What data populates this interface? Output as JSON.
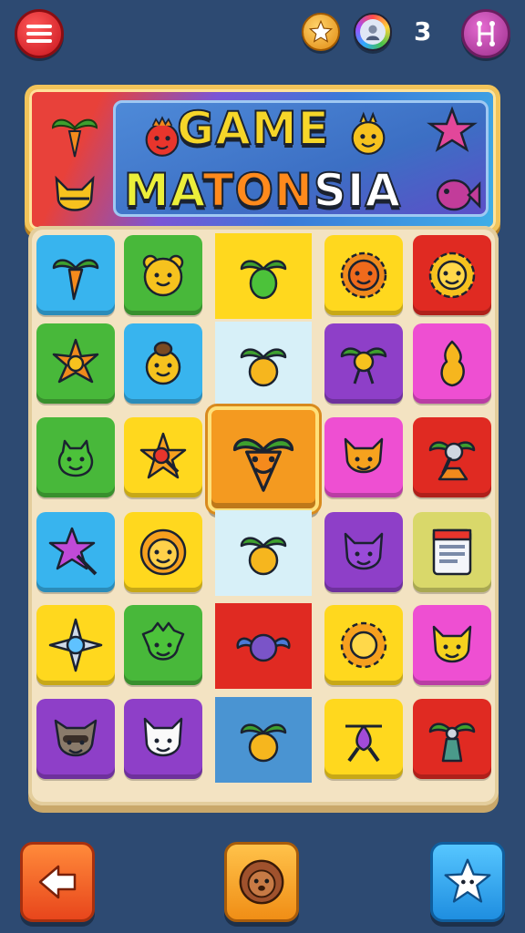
{
  "game": {
    "title_line1": "GAME",
    "title_line2_parts": [
      "MA",
      "TON",
      "SIA"
    ],
    "moves_count": "3"
  },
  "topbar": {
    "menu_icon": "hamburger-menu-icon",
    "star_icon": "star-coin-icon",
    "avatar_icon": "player-avatar-icon",
    "grid_icon": "grid-network-icon"
  },
  "colors": {
    "background": "#2d4a72",
    "board": "#f3e3c2",
    "tile_blue": "#38b4ee",
    "tile_green": "#48b83a",
    "tile_yellow": "#ffd81e",
    "tile_red": "#e02a22",
    "tile_purple": "#8e3fc8",
    "tile_pink": "#ee4fd2",
    "tile_orange": "#f49a20",
    "tile_paleblue": "#d7f0f8",
    "tile_steelblue": "#4a94d2"
  },
  "board": {
    "rows": [
      [
        {
          "color": "blue",
          "icon": "carrot-icon"
        },
        {
          "color": "green",
          "icon": "bear-face-icon"
        },
        {
          "color": "yellow-flat",
          "icon": "leaf-fruit-icon"
        },
        {
          "color": "yellow",
          "icon": "sun-face-icon"
        },
        {
          "color": "red",
          "icon": "sunflower-face-icon"
        }
      ],
      [
        {
          "color": "green",
          "icon": "flower-icon"
        },
        {
          "color": "blue",
          "icon": "bear-with-hat-icon"
        },
        {
          "color": "paleblue-flat",
          "icon": "palm-orange-icon"
        },
        {
          "color": "purple",
          "icon": "palm-pin-icon"
        },
        {
          "color": "pink",
          "icon": "gourd-icon"
        }
      ],
      [
        {
          "color": "green",
          "icon": "frog-icon"
        },
        {
          "color": "yellow",
          "icon": "star-magnifier-icon"
        },
        {
          "color": "orange-selected",
          "icon": "carrot-face-icon"
        },
        {
          "color": "pink",
          "icon": "fox-face-icon"
        },
        {
          "color": "red",
          "icon": "lamp-pyramid-icon"
        }
      ],
      [
        {
          "color": "blue",
          "icon": "star-wand-icon"
        },
        {
          "color": "yellow",
          "icon": "lion-face-icon"
        },
        {
          "color": "paleblue-flat",
          "icon": "palm-orange-icon"
        },
        {
          "color": "purple",
          "icon": "cat-face-icon"
        },
        {
          "color": "olive",
          "icon": "document-icon"
        }
      ],
      [
        {
          "color": "yellow",
          "icon": "shuriken-gem-icon"
        },
        {
          "color": "green",
          "icon": "dragon-face-icon"
        },
        {
          "color": "red-flat",
          "icon": "winged-ball-icon"
        },
        {
          "color": "yellow",
          "icon": "sun-icon"
        },
        {
          "color": "pink",
          "icon": "cat-yellow-icon"
        }
      ],
      [
        {
          "color": "purple",
          "icon": "raccoon-face-icon"
        },
        {
          "color": "purple",
          "icon": "white-cat-icon"
        },
        {
          "color": "steelblue-flat",
          "icon": "palm-orange-icon"
        },
        {
          "color": "yellow",
          "icon": "drop-pin-icon"
        },
        {
          "color": "red",
          "icon": "trophy-lamp-icon"
        }
      ]
    ]
  },
  "bottom": {
    "back_icon": "arrow-left-icon",
    "center_icon": "lion-avatar-icon",
    "star_icon": "star-face-icon"
  }
}
